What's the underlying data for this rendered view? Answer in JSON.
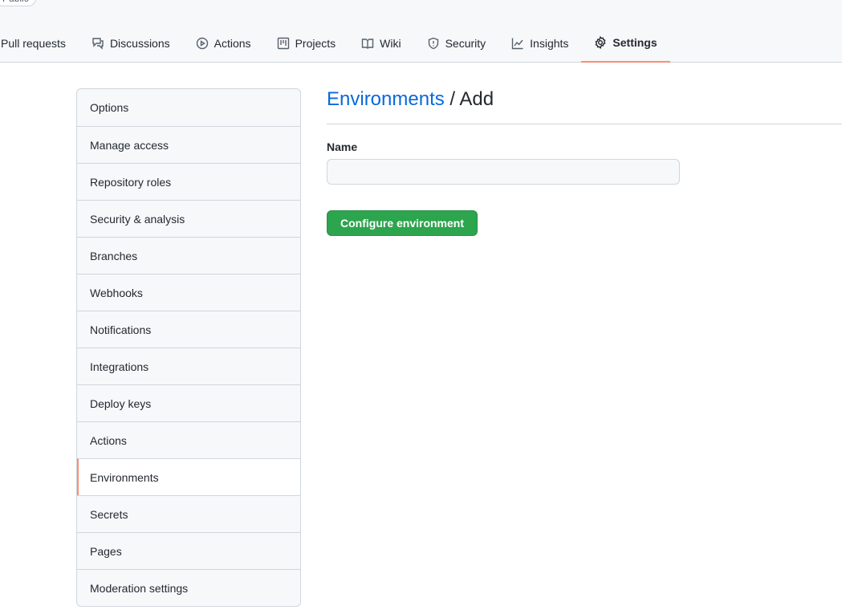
{
  "header": {
    "visibility_badge": "Public",
    "tabs": [
      {
        "label": "Pull requests",
        "icon": "pull-request-icon"
      },
      {
        "label": "Discussions",
        "icon": "discussions-icon"
      },
      {
        "label": "Actions",
        "icon": "play-icon"
      },
      {
        "label": "Projects",
        "icon": "project-icon"
      },
      {
        "label": "Wiki",
        "icon": "book-icon"
      },
      {
        "label": "Security",
        "icon": "shield-icon"
      },
      {
        "label": "Insights",
        "icon": "graph-icon"
      },
      {
        "label": "Settings",
        "icon": "gear-icon",
        "active": true
      }
    ]
  },
  "sidebar": {
    "items": [
      "Options",
      "Manage access",
      "Repository roles",
      "Security & analysis",
      "Branches",
      "Webhooks",
      "Notifications",
      "Integrations",
      "Deploy keys",
      "Actions",
      "Environments",
      "Secrets",
      "Pages",
      "Moderation settings"
    ],
    "active": "Environments"
  },
  "main": {
    "breadcrumb_link": "Environments",
    "breadcrumb_sep": " / ",
    "title": "Add",
    "name_label": "Name",
    "name_value": "",
    "submit_label": "Configure environment"
  },
  "colors": {
    "accent": "#fd8c73",
    "primary_button": "#2da44e",
    "link": "#0969da"
  }
}
